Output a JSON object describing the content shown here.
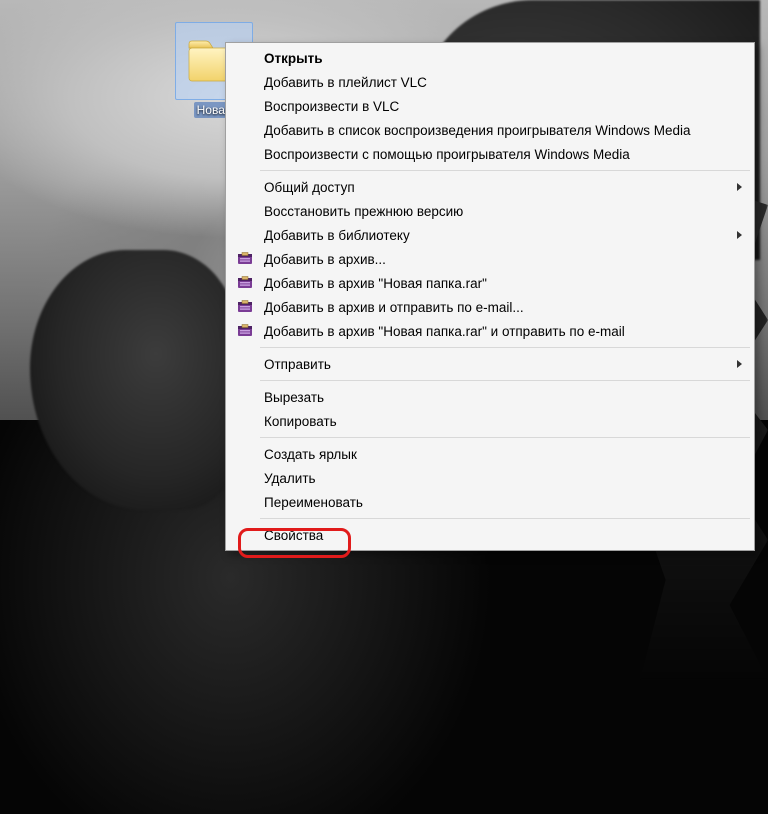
{
  "desktop": {
    "icon_label": "Новая"
  },
  "menu": {
    "open": "Открыть",
    "add_playlist_vlc": "Добавить в плейлист VLC",
    "play_vlc": "Воспроизвести в VLC",
    "add_wmp_playlist": "Добавить в список воспроизведения проигрывателя Windows Media",
    "play_wmp": "Воспроизвести с помощью проигрывателя Windows Media",
    "share": "Общий доступ",
    "restore_prev": "Восстановить прежнюю версию",
    "add_library": "Добавить в библиотеку",
    "rar_add": "Добавить в архив...",
    "rar_add_named": "Добавить в архив \"Новая папка.rar\"",
    "rar_add_email": "Добавить в архив и отправить по e-mail...",
    "rar_add_named_email": "Добавить в архив \"Новая папка.rar\" и отправить по e-mail",
    "send_to": "Отправить",
    "cut": "Вырезать",
    "copy": "Копировать",
    "create_shortcut": "Создать ярлык",
    "delete": "Удалить",
    "rename": "Переименовать",
    "properties": "Свойства"
  }
}
